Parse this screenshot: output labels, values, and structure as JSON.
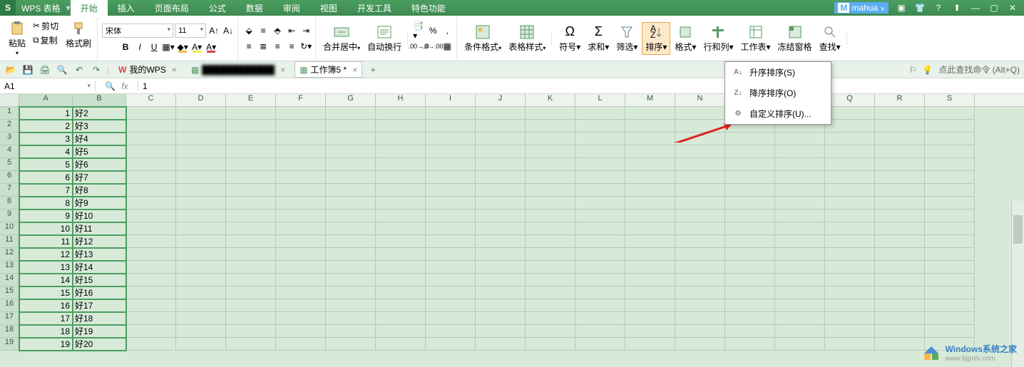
{
  "app": {
    "name": "WPS 表格",
    "user": "mahua"
  },
  "tabs": [
    "开始",
    "插入",
    "页面布局",
    "公式",
    "数据",
    "审阅",
    "视图",
    "开发工具",
    "特色功能"
  ],
  "activeTab": 0,
  "ribbon": {
    "paste": "粘贴",
    "cut": "剪切",
    "copy": "复制",
    "formatPainter": "格式刷",
    "font": "宋体",
    "fontSize": "11",
    "mergeCenter": "合并居中",
    "wrap": "自动换行",
    "condFormat": "条件格式",
    "tableStyle": "表格样式",
    "symbol": "符号",
    "sum": "求和",
    "filter": "筛选",
    "sort": "排序",
    "format": "格式",
    "rowCol": "行和列",
    "worksheet": "工作表",
    "freeze": "冻结窗格",
    "find": "查找"
  },
  "docbar": {
    "wps": "我的WPS",
    "tab2": "████████████",
    "tab3": "工作簿5 *",
    "searchHint": "点此查找命令 (Alt+Q)"
  },
  "namebox": "A1",
  "formula": "1",
  "columns": [
    "A",
    "B",
    "C",
    "D",
    "E",
    "F",
    "G",
    "H",
    "I",
    "J",
    "K",
    "L",
    "M",
    "N",
    "O",
    "P",
    "Q",
    "R",
    "S"
  ],
  "rowCount": 19,
  "cells": {
    "A": [
      1,
      2,
      3,
      4,
      5,
      6,
      7,
      8,
      9,
      10,
      11,
      12,
      13,
      14,
      15,
      16,
      17,
      18,
      19
    ],
    "B": [
      "好2",
      "好3",
      "好4",
      "好5",
      "好6",
      "好7",
      "好8",
      "好9",
      "好10",
      "好11",
      "好12",
      "好13",
      "好14",
      "好15",
      "好16",
      "好17",
      "好18",
      "好19",
      "好20"
    ]
  },
  "dropdown": {
    "asc": "升序排序(S)",
    "desc": "降序排序(O)",
    "custom": "自定义排序(U)..."
  },
  "watermark": {
    "title": "Windows系统之家",
    "url": "www.bjjmlv.com"
  }
}
